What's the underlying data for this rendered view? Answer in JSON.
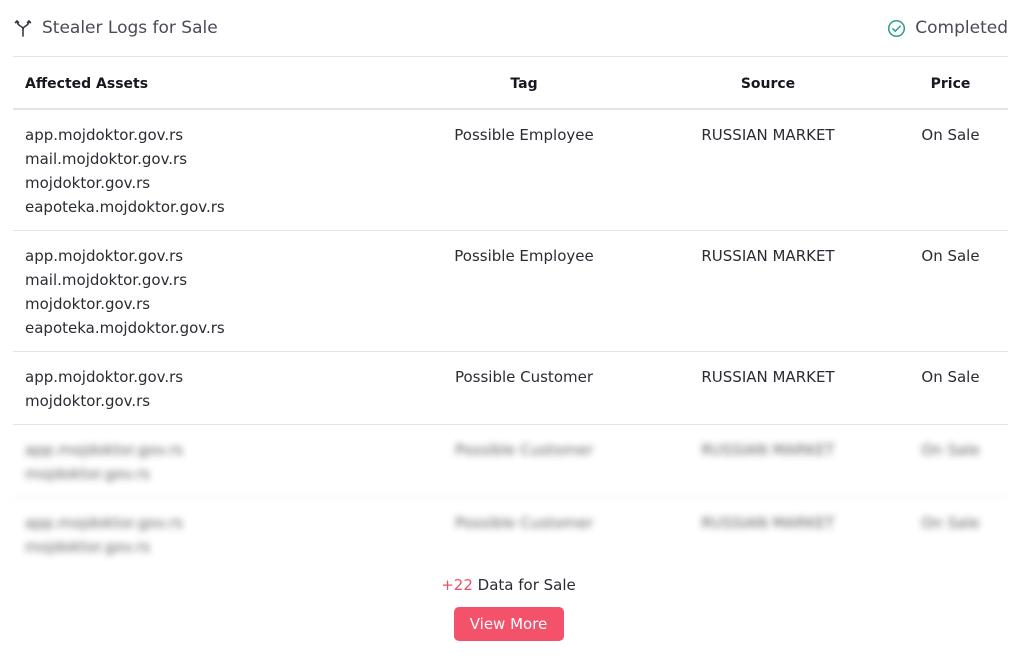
{
  "header": {
    "title": "Stealer Logs for Sale",
    "status": "Completed",
    "icon": "fork-icon",
    "status_icon": "check-circle-icon",
    "status_color": "#2e9c8f"
  },
  "table": {
    "columns": [
      "Affected Assets",
      "Tag",
      "Source",
      "Price"
    ],
    "rows": [
      {
        "assets": [
          "app.mojdoktor.gov.rs",
          "mail.mojdoktor.gov.rs",
          "mojdoktor.gov.rs",
          "eapoteka.mojdoktor.gov.rs"
        ],
        "tag": "Possible Employee",
        "source": "RUSSIAN MARKET",
        "price": "On Sale"
      },
      {
        "assets": [
          "app.mojdoktor.gov.rs",
          "mail.mojdoktor.gov.rs",
          "mojdoktor.gov.rs",
          "eapoteka.mojdoktor.gov.rs"
        ],
        "tag": "Possible Employee",
        "source": "RUSSIAN MARKET",
        "price": "On Sale"
      },
      {
        "assets": [
          "app.mojdoktor.gov.rs",
          "mojdoktor.gov.rs"
        ],
        "tag": "Possible Customer",
        "source": "RUSSIAN MARKET",
        "price": "On Sale"
      },
      {
        "assets": [
          "app.mojdoktor.gov.rs",
          "mojdoktor.gov.rs"
        ],
        "tag": "Possible Customer",
        "source": "RUSSIAN MARKET",
        "price": "On Sale"
      },
      {
        "assets": [
          "app.mojdoktor.gov.rs",
          "mojdoktor.gov.rs"
        ],
        "tag": "Possible Customer",
        "source": "RUSSIAN MARKET",
        "price": "On Sale"
      }
    ]
  },
  "footer": {
    "more_count": "+22",
    "more_label": "Data for Sale",
    "button_label": "View More",
    "accent_color": "#f4516a"
  }
}
